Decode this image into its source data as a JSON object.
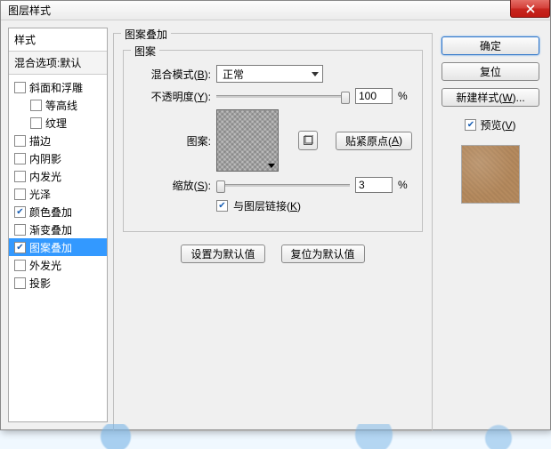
{
  "title": "图层样式",
  "styles": {
    "header": "样式",
    "blend_options": "混合选项:默认",
    "items": [
      {
        "label": "斜面和浮雕",
        "checked": false,
        "indent": false
      },
      {
        "label": "等高线",
        "checked": false,
        "indent": true
      },
      {
        "label": "纹理",
        "checked": false,
        "indent": true
      },
      {
        "label": "描边",
        "checked": false,
        "indent": false
      },
      {
        "label": "内阴影",
        "checked": false,
        "indent": false
      },
      {
        "label": "内发光",
        "checked": false,
        "indent": false
      },
      {
        "label": "光泽",
        "checked": false,
        "indent": false
      },
      {
        "label": "颜色叠加",
        "checked": true,
        "indent": false
      },
      {
        "label": "渐变叠加",
        "checked": false,
        "indent": false
      },
      {
        "label": "图案叠加",
        "checked": true,
        "indent": false,
        "selected": true
      },
      {
        "label": "外发光",
        "checked": false,
        "indent": false
      },
      {
        "label": "投影",
        "checked": false,
        "indent": false
      }
    ]
  },
  "overlay": {
    "group_label": "图案叠加",
    "section_label": "图案",
    "blend_mode_label_pre": "混合模式(",
    "blend_mode_hot": "B",
    "blend_mode_label_post": "):",
    "blend_mode_value": "正常",
    "opacity_label_pre": "不透明度(",
    "opacity_hot": "Y",
    "opacity_label_post": "):",
    "opacity_value": "100",
    "percent": "%",
    "pattern_label": "图案:",
    "snap_origin_pre": "贴紧原点(",
    "snap_origin_hot": "A",
    "snap_origin_post": ")",
    "scale_label_pre": "缩放(",
    "scale_hot": "S",
    "scale_label_post": "):",
    "scale_value": "3",
    "link_label_pre": "与图层链接(",
    "link_hot": "K",
    "link_label_post": ")",
    "link_checked": true,
    "set_default": "设置为默认值",
    "reset_default": "复位为默认值"
  },
  "buttons": {
    "ok": "确定",
    "cancel": "复位",
    "new_style_pre": "新建样式(",
    "new_style_hot": "W",
    "new_style_post": ")...",
    "preview_pre": "预览(",
    "preview_hot": "V",
    "preview_post": ")",
    "preview_checked": true
  }
}
